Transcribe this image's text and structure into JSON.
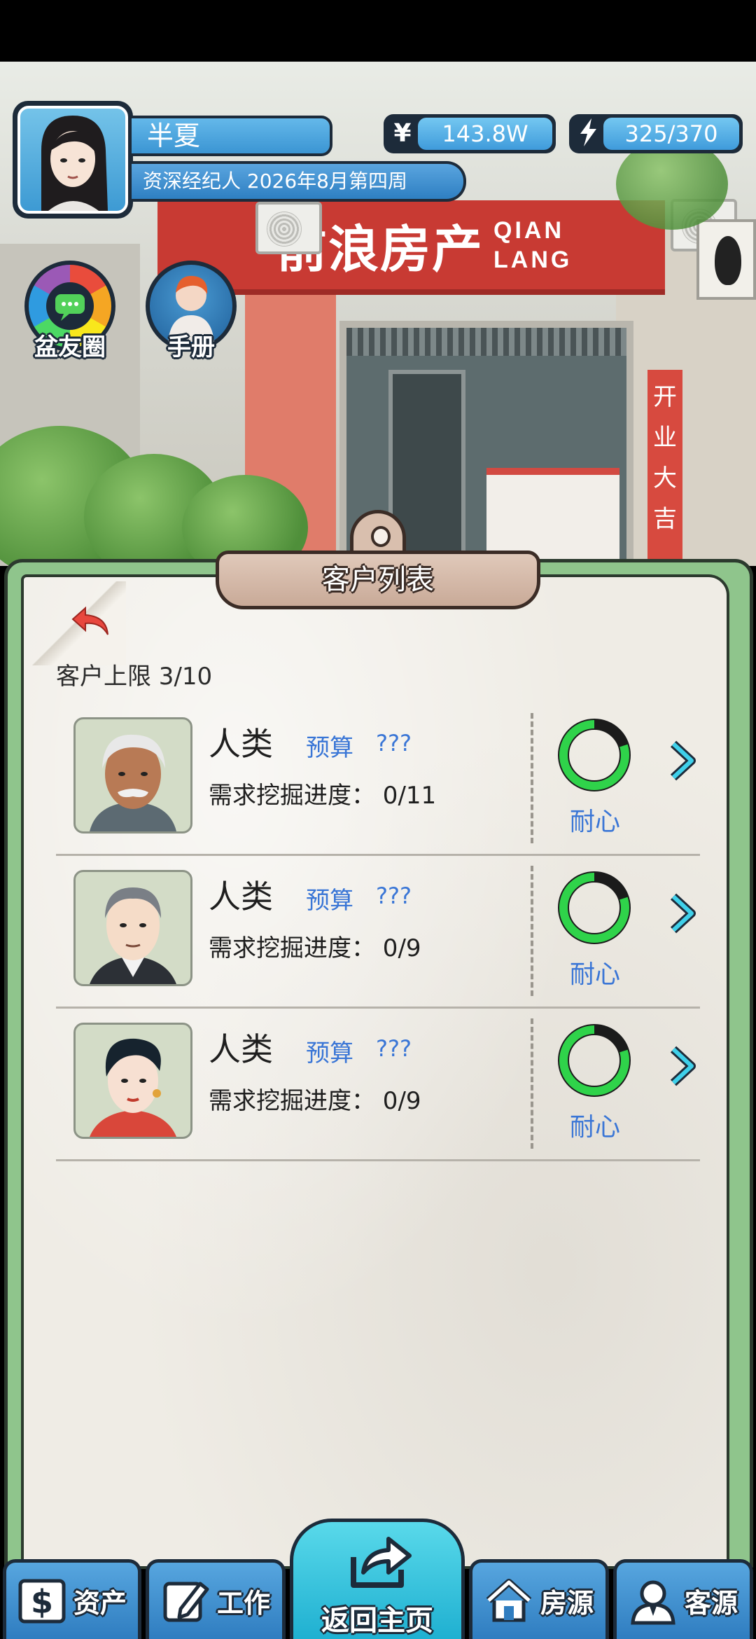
{
  "player": {
    "name": "半夏",
    "title_date": "资深经纪人 2026年8月第四周"
  },
  "resources": {
    "money_icon": "yen-icon",
    "money": "143.8W",
    "energy_icon": "lightning-icon",
    "energy": "325/370"
  },
  "scene": {
    "shop_name_cn": "前浪房产",
    "shop_name_en_1": "QIAN",
    "shop_name_en_2": "LANG",
    "banner": "开业大吉"
  },
  "shortcuts": {
    "moments": "盆友圈",
    "handbook": "手册"
  },
  "panel": {
    "title": "客户列表",
    "limit": "客户上限 3/10"
  },
  "customers": [
    {
      "name": "人类",
      "budget_label": "预算",
      "budget_value": "???",
      "progress": "需求挖掘进度：  0/11",
      "patience_label": "耐心",
      "patience": 0.8
    },
    {
      "name": "人类",
      "budget_label": "预算",
      "budget_value": "???",
      "progress": "需求挖掘进度：  0/9",
      "patience_label": "耐心",
      "patience": 0.8
    },
    {
      "name": "人类",
      "budget_label": "预算",
      "budget_value": "???",
      "progress": "需求挖掘进度：  0/9",
      "patience_label": "耐心",
      "patience": 0.8
    }
  ],
  "nav": {
    "assets": "资产",
    "work": "工作",
    "home": "返回主页",
    "houses": "房源",
    "clients": "客源"
  },
  "colors": {
    "accent_blue": "#3a76d6",
    "patience_green": "#2fd34a",
    "board_green": "#8fc58c"
  }
}
